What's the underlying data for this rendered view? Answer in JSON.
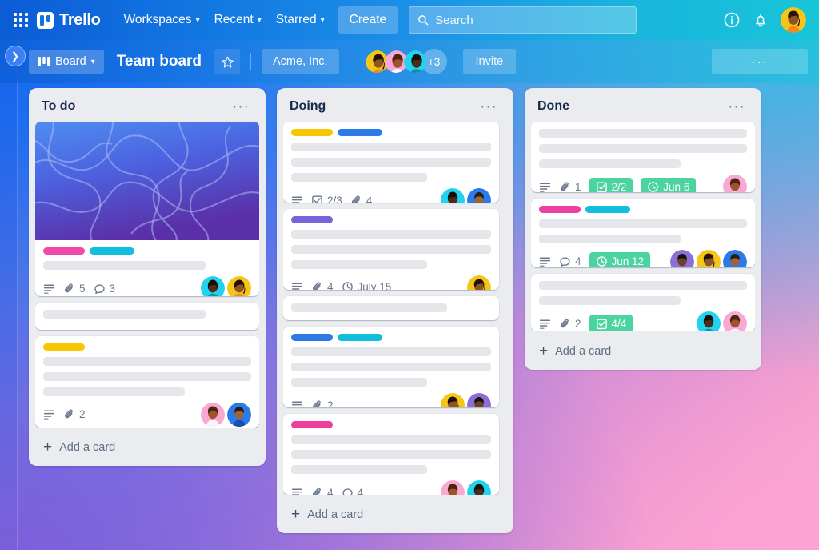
{
  "topnav": {
    "apps_icon": "grid-apps-icon",
    "brand": "Trello",
    "items": [
      {
        "label": "Workspaces",
        "caret": "⌄"
      },
      {
        "label": "Recent",
        "caret": "⌄"
      },
      {
        "label": "Starred",
        "caret": "⌄"
      }
    ],
    "create_label": "Create",
    "search": {
      "placeholder": "Search",
      "value": "",
      "icon": "search-icon"
    },
    "info_icon": "info-circle-icon",
    "bell_icon": "notification-bell-icon",
    "account_avatar": "user-avatar"
  },
  "boardbar": {
    "sidebar_toggle_icon": "chevron-right-icon",
    "view_chip": {
      "label": "Board",
      "icon": "board-view-icon",
      "caret": "⌄"
    },
    "title": "Team board",
    "star_icon": "star-outline-icon",
    "org": "Acme, Inc.",
    "members": [
      "member-avatar-1",
      "member-avatar-2",
      "member-avatar-3"
    ],
    "more_members": "+3",
    "invite_label": "Invite",
    "overflow_label": "···"
  },
  "colors": {
    "label_pink": "#ef4aa8",
    "label_cyan": "#12bede",
    "label_yellow": "#f7c600",
    "label_blue": "#2a7ae9",
    "label_purple": "#7b63dd",
    "label_magenta": "#ee3fa0",
    "badge_green": "#4cd4a0",
    "list_bg": "#ebecf0",
    "card_bg": "#ffffff"
  },
  "lists": [
    {
      "title": "To do",
      "menu": "···",
      "add_card": "Add a card",
      "scroll": false,
      "cards": [
        {
          "cover": true,
          "labels": [
            "label_pink",
            "label_cyan"
          ],
          "placeholders": [
            1
          ],
          "meta": [
            {
              "type": "icon",
              "icon": "description-icon"
            },
            {
              "type": "count",
              "icon": "attachment-icon",
              "value": "5"
            },
            {
              "type": "count",
              "icon": "comment-icon",
              "value": "3"
            }
          ],
          "avatars": [
            "avatar-cyan-f",
            "avatar-yellow-f"
          ]
        },
        {
          "cover": false,
          "labels": [],
          "placeholders": [
            1
          ],
          "meta": [],
          "avatars": []
        },
        {
          "cover": false,
          "labels": [
            "label_yellow"
          ],
          "placeholders": [
            1,
            2
          ],
          "meta": [
            {
              "type": "icon",
              "icon": "description-icon"
            },
            {
              "type": "count",
              "icon": "attachment-icon",
              "value": "2"
            }
          ],
          "avatars": [
            "avatar-pink-m",
            "avatar-blue-m"
          ]
        }
      ]
    },
    {
      "title": "Doing",
      "menu": "···",
      "add_card": "Add a card",
      "scroll": true,
      "cards": [
        {
          "cover": false,
          "labels": [
            "label_yellow",
            "label_blue"
          ],
          "placeholders": [
            1,
            2
          ],
          "meta": [
            {
              "type": "icon",
              "icon": "description-icon"
            },
            {
              "type": "count",
              "icon": "checklist-icon",
              "value": "2/3"
            },
            {
              "type": "count",
              "icon": "attachment-icon",
              "value": "4"
            }
          ],
          "avatars": [
            "avatar-cyan-f",
            "avatar-blue-m"
          ]
        },
        {
          "cover": false,
          "labels": [
            "label_purple"
          ],
          "placeholders": [
            1,
            2
          ],
          "meta": [
            {
              "type": "icon",
              "icon": "description-icon"
            },
            {
              "type": "count",
              "icon": "attachment-icon",
              "value": "4"
            },
            {
              "type": "count",
              "icon": "clock-icon",
              "value": "July 15"
            }
          ],
          "avatars": [
            "avatar-yellow-f"
          ]
        },
        {
          "cover": false,
          "labels": [],
          "placeholders": [
            1
          ],
          "meta": [],
          "avatars": []
        },
        {
          "cover": false,
          "labels": [
            "label_blue",
            "label_cyan"
          ],
          "placeholders": [
            1,
            2
          ],
          "meta": [
            {
              "type": "icon",
              "icon": "description-icon"
            },
            {
              "type": "count",
              "icon": "attachment-icon",
              "value": "2"
            }
          ],
          "avatars": [
            "avatar-yellow-f",
            "avatar-purple-m"
          ]
        },
        {
          "cover": false,
          "labels": [
            "label_magenta"
          ],
          "placeholders": [
            1,
            2
          ],
          "meta": [
            {
              "type": "icon",
              "icon": "description-icon"
            },
            {
              "type": "count",
              "icon": "attachment-icon",
              "value": "4"
            },
            {
              "type": "count",
              "icon": "comment-icon",
              "value": "4"
            }
          ],
          "avatars": [
            "avatar-pink-m",
            "avatar-cyan-f"
          ]
        }
      ]
    },
    {
      "title": "Done",
      "menu": "···",
      "add_card": "Add a card",
      "scroll": false,
      "cards": [
        {
          "cover": false,
          "labels": [],
          "placeholders": [
            1,
            2
          ],
          "meta": [
            {
              "type": "icon",
              "icon": "description-icon"
            },
            {
              "type": "count",
              "icon": "attachment-icon",
              "value": "1"
            },
            {
              "type": "badge",
              "icon": "checklist-icon",
              "value": "2/2"
            },
            {
              "type": "badge",
              "icon": "clock-icon",
              "value": "Jun 6"
            }
          ],
          "avatars": [
            "avatar-pink-m"
          ]
        },
        {
          "cover": false,
          "labels": [
            "label_magenta",
            "label_cyan"
          ],
          "placeholders": [
            2
          ],
          "meta": [
            {
              "type": "icon",
              "icon": "description-icon"
            },
            {
              "type": "count",
              "icon": "comment-icon",
              "value": "4"
            },
            {
              "type": "badge",
              "icon": "clock-icon",
              "value": "Jun 12"
            }
          ],
          "avatars": [
            "avatar-purple-m",
            "avatar-yellow-f",
            "avatar-blue-m"
          ]
        },
        {
          "cover": false,
          "labels": [],
          "placeholders": [
            2
          ],
          "meta": [
            {
              "type": "icon",
              "icon": "description-icon"
            },
            {
              "type": "count",
              "icon": "attachment-icon",
              "value": "2"
            },
            {
              "type": "badge",
              "icon": "checklist-icon",
              "value": "4/4"
            }
          ],
          "avatars": [
            "avatar-cyan-f",
            "avatar-pink-m"
          ]
        }
      ]
    }
  ]
}
